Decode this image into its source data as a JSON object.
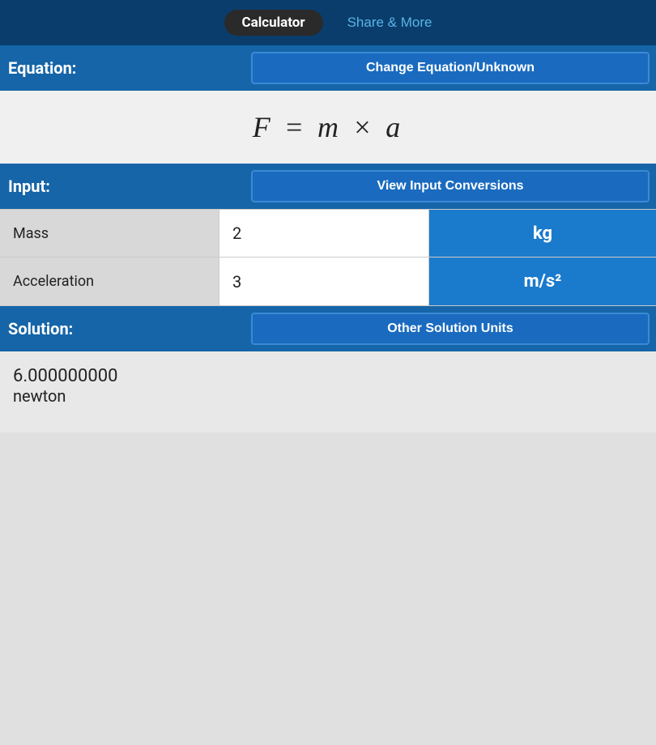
{
  "header": {
    "tab_calculator_label": "Calculator",
    "tab_share_label": "Share & More"
  },
  "equation_row": {
    "label": "Equation:",
    "button_label": "Change Equation/Unknown"
  },
  "formula": {
    "display": "F = m × a"
  },
  "input_section": {
    "label": "Input:",
    "button_label": "View Input Conversions",
    "rows": [
      {
        "label": "Mass",
        "value": "2",
        "unit": "kg"
      },
      {
        "label": "Acceleration",
        "value": "3",
        "unit": "m/s²"
      }
    ]
  },
  "solution_section": {
    "label": "Solution:",
    "button_label": "Other Solution Units",
    "value": "6.000000000",
    "unit": "newton"
  }
}
